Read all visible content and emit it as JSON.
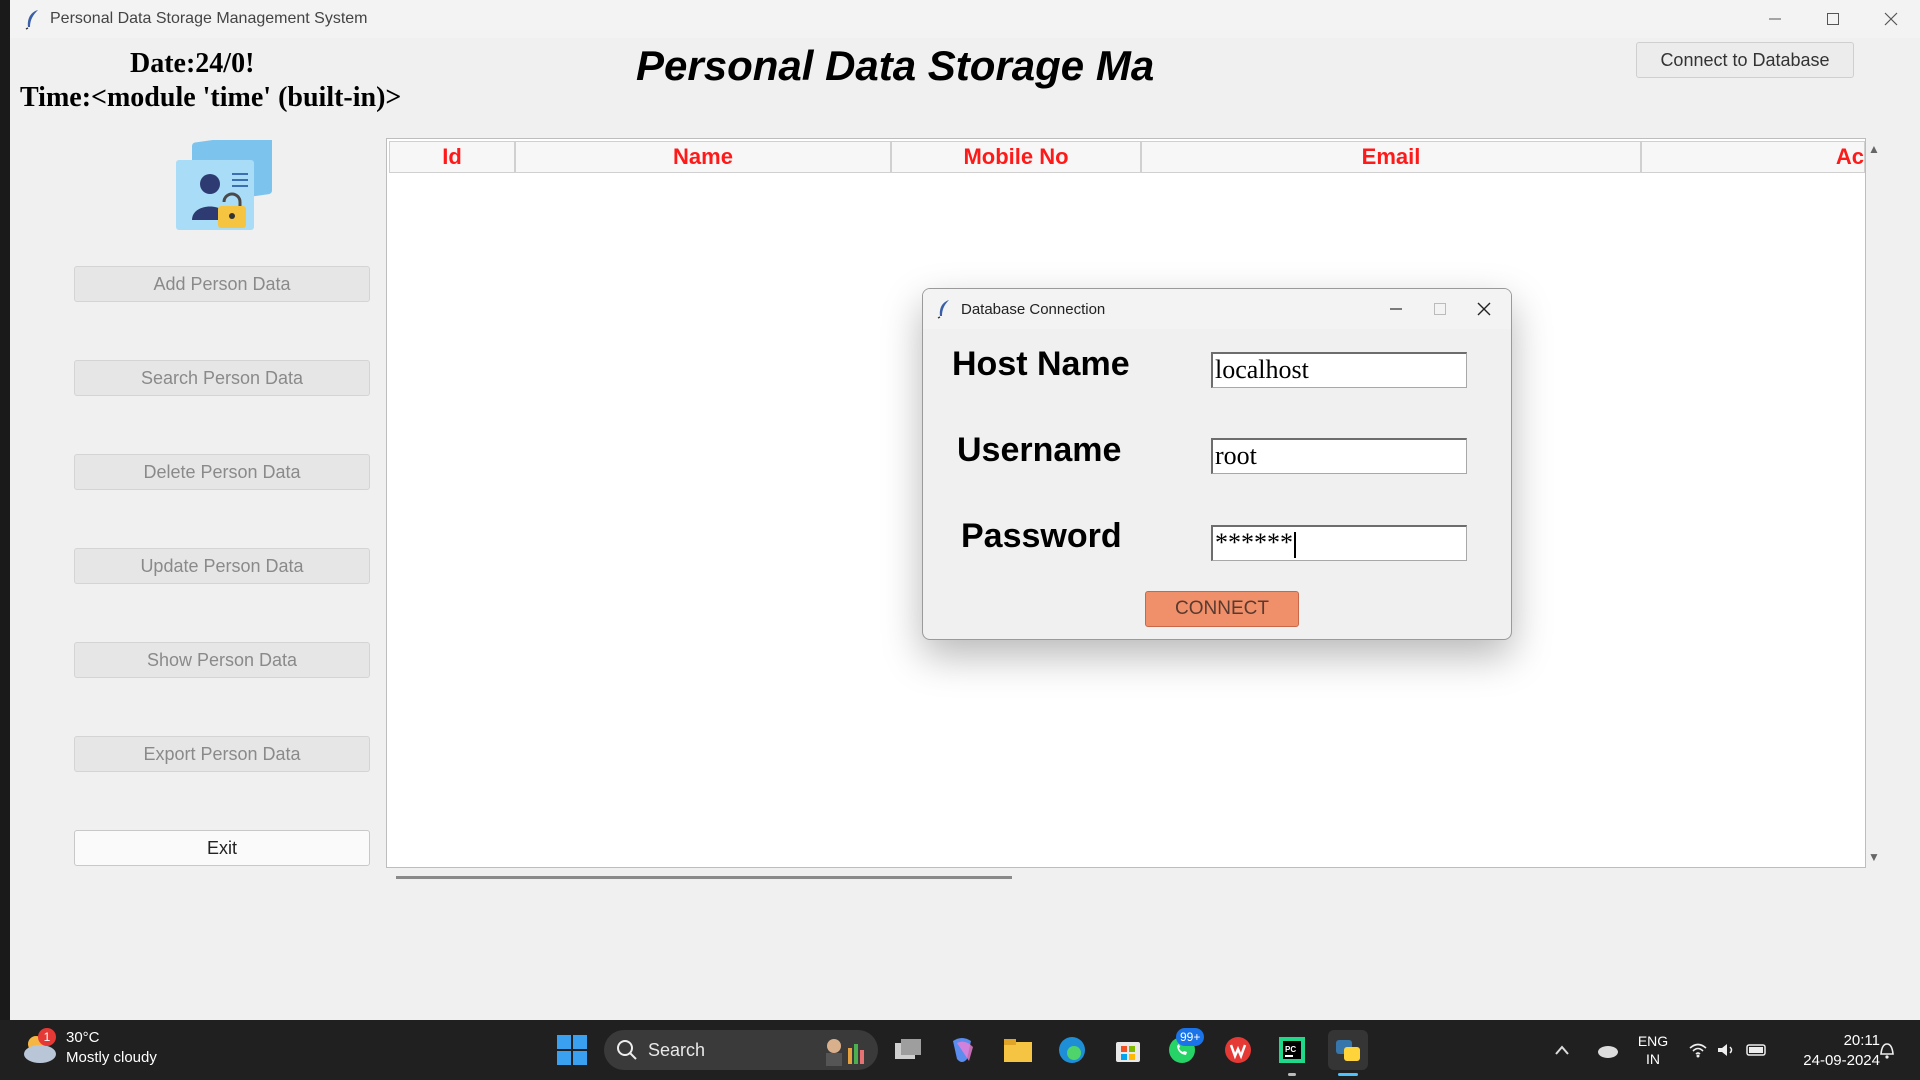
{
  "window": {
    "title": "Personal Data Storage Management System"
  },
  "header": {
    "date": "Date:24/0!",
    "time": "Time:<module 'time' (built-in)>",
    "title": "Personal Data Storage Ma",
    "connect_db_label": "Connect to Database"
  },
  "sidebar": {
    "buttons": [
      {
        "label": "Add Person Data"
      },
      {
        "label": "Search Person Data"
      },
      {
        "label": "Delete Person Data"
      },
      {
        "label": "Update Person Data"
      },
      {
        "label": "Show Person Data"
      },
      {
        "label": "Export Person Data"
      },
      {
        "label": "Exit"
      }
    ]
  },
  "table": {
    "columns": [
      "Id",
      "Name",
      "Mobile No",
      "Email",
      "Ac"
    ],
    "header_color": "#ff1a1a"
  },
  "dialog": {
    "title": "Database Connection",
    "host_label": "Host Name",
    "host_value": "localhost",
    "username_label": "Username",
    "username_value": "root",
    "password_label": "Password",
    "password_value": "******",
    "connect_label": "CONNECT",
    "connect_color": "#f0906a"
  },
  "taskbar": {
    "weather_temp": "30°C",
    "weather_desc": "Mostly cloudy",
    "weather_badge": "1",
    "search_label": "Search",
    "whatsapp_badge": "99+",
    "lang_line1": "ENG",
    "lang_line2": "IN",
    "time": "20:11",
    "date": "24-09-2024",
    "apps": [
      "task-view",
      "copilot",
      "file-explorer",
      "edge",
      "microsoft-store",
      "whatsapp",
      "wps-office",
      "pycharm",
      "python"
    ]
  }
}
